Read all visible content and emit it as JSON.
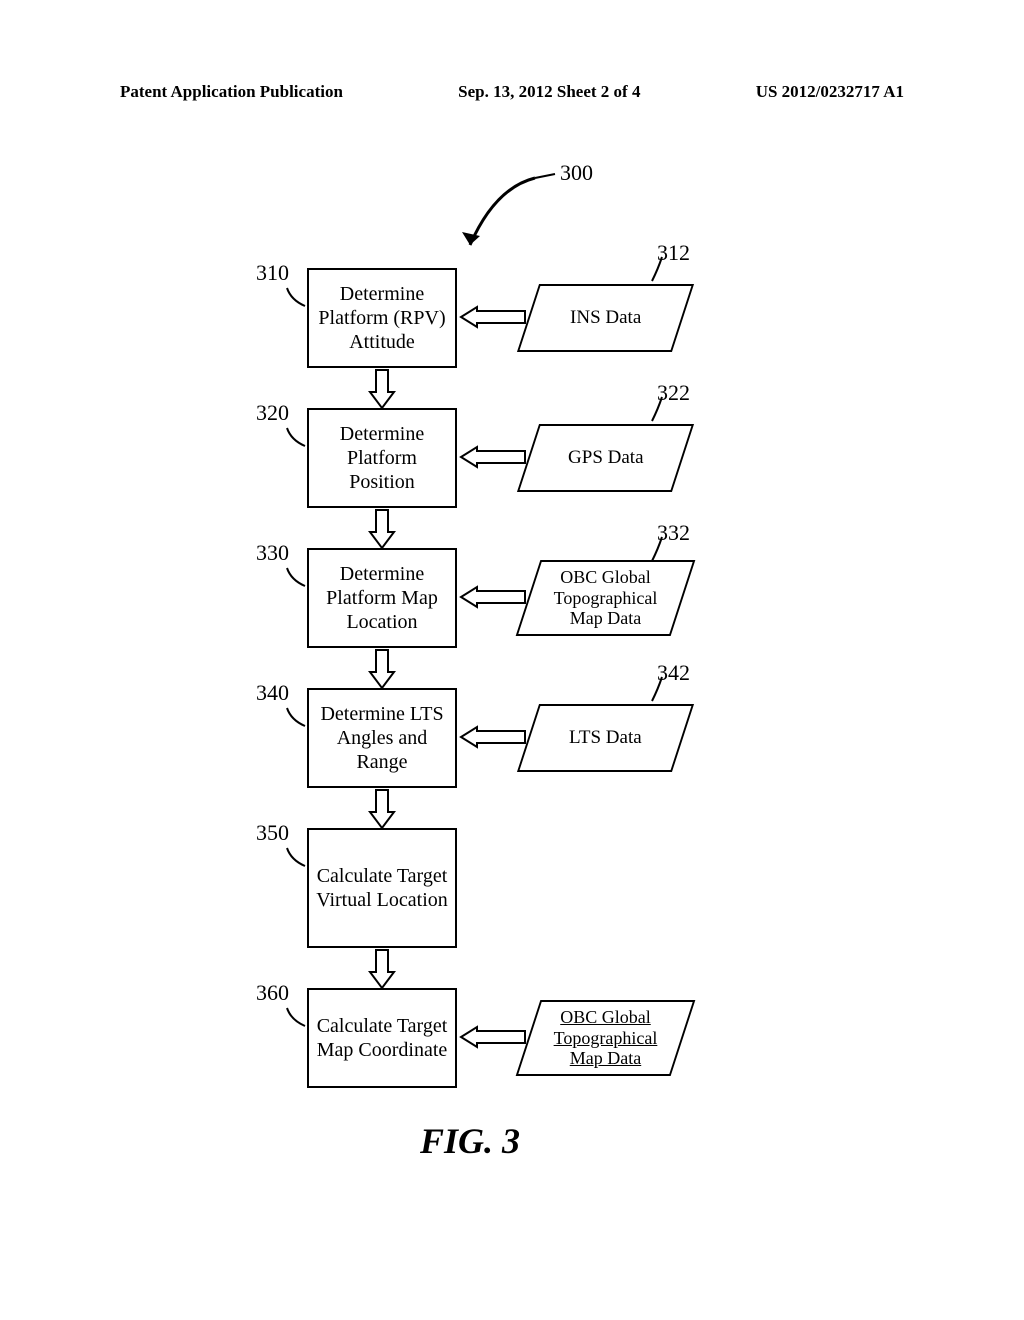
{
  "header": {
    "left": "Patent Application Publication",
    "center": "Sep. 13, 2012  Sheet 2 of 4",
    "right": "US 2012/0232717 A1"
  },
  "labels": {
    "main": "300",
    "box310": "310",
    "box320": "320",
    "box330": "330",
    "box340": "340",
    "box350": "350",
    "box360": "360",
    "data312": "312",
    "data322": "322",
    "data332": "332",
    "data342": "342"
  },
  "boxes": {
    "b310": "Determine Platform (RPV) Attitude",
    "b320": "Determine Platform Position",
    "b330": "Determine Platform Map Location",
    "b340": "Determine LTS Angles and Range",
    "b350": "Calculate Target Virtual Location",
    "b360": "Calculate Target Map Coordinate"
  },
  "data": {
    "d312": "INS Data",
    "d322": "GPS Data",
    "d332": "OBC Global Topographical Map Data",
    "d342": "LTS Data",
    "d360": "OBC Global Topographical Map Data"
  },
  "caption": "FIG. 3"
}
